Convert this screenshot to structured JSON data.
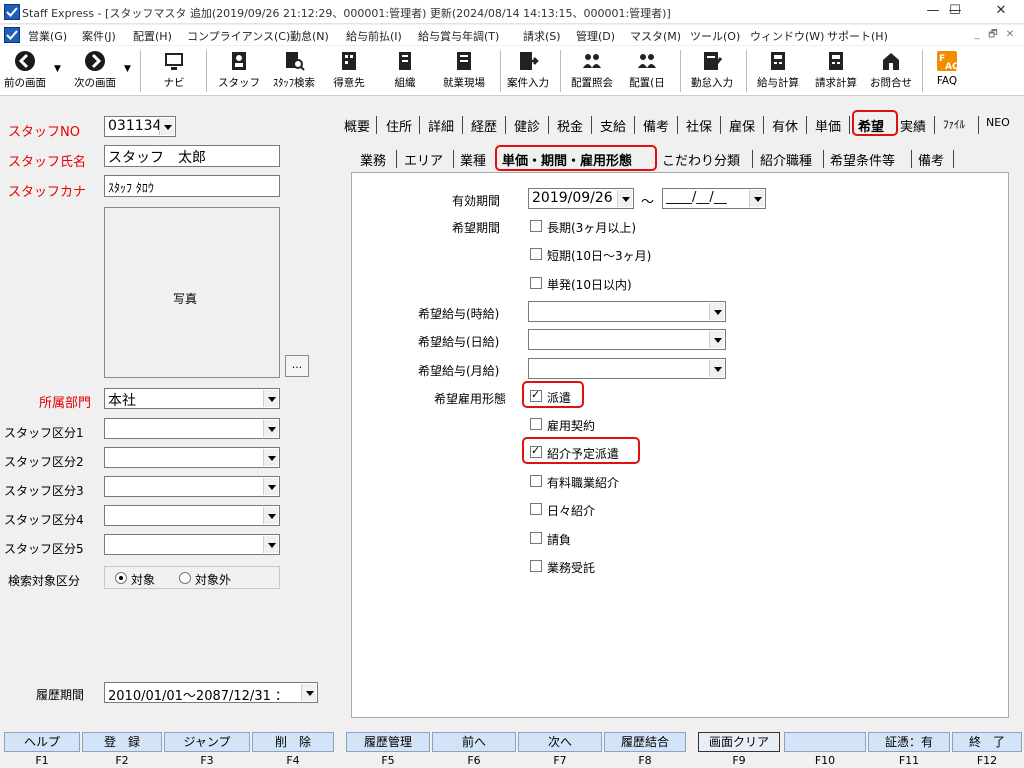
{
  "window": {
    "title": "Staff Express - [スタッフマスタ  追加(2019/09/26 21:12:29、000001:管理者)  更新(2024/08/14 14:13:15、000001:管理者)]",
    "minimize": "—",
    "maximize": "☐",
    "close": "✕"
  },
  "menu": [
    "営業(G)",
    "案件(J)",
    "配置(H)",
    "コンプライアンス(C)",
    "勤怠(N)",
    "給与前払(I)",
    "給与賞与年調(T)",
    "請求(S)",
    "管理(D)",
    "マスタ(M)",
    "ツール(O)",
    "ウィンドウ(W)",
    "サポート(H)"
  ],
  "mdi": [
    "_",
    "🗗",
    "✕"
  ],
  "toolbar": {
    "prev": "前の画面",
    "next": "次の画面",
    "navi": "ナビ",
    "staff": "スタッフ",
    "staff_search": "ｽﾀｯﾌ検索",
    "client": "得意先",
    "org": "組織",
    "site": "就業現場",
    "order_input": "案件入力",
    "assign_view": "配置照会",
    "assign_day": "配置(日",
    "attendance": "勤怠入力",
    "payroll": "給与計算",
    "billing": "請求計算",
    "inquiry": "お問合せ",
    "faq": "FAQ"
  },
  "left": {
    "staff_no_label": "スタッフNO",
    "staff_no": "031134",
    "staff_name_label": "スタッフ氏名",
    "staff_name": "スタッフ　太郎",
    "staff_kana_label": "スタッフカナ",
    "staff_kana": "ｽﾀｯﾌ ﾀﾛｳ",
    "photo_label": "写真",
    "photo_button": "...",
    "dept_label": "所属部門",
    "dept": "本社",
    "class_labels": [
      "スタッフ区分1",
      "スタッフ区分2",
      "スタッフ区分3",
      "スタッフ区分4",
      "スタッフ区分5"
    ],
    "search_label": "検索対象区分",
    "search_on": "対象",
    "search_off": "対象外",
    "history_label": "履歴期間",
    "history": "2010/01/01～2087/12/31 ："
  },
  "tabs_main": [
    "概要",
    "住所",
    "詳細",
    "経歴",
    "健診",
    "税金",
    "支給",
    "備考",
    "社保",
    "雇保",
    "有休",
    "単価",
    "希望",
    "実績",
    "ﾌｧｲﾙ",
    "NEO"
  ],
  "tabs_sub": [
    "業務",
    "エリア",
    "業種",
    "単価・期間・雇用形態",
    "こだわり分類",
    "紹介職種",
    "希望条件等",
    "備考"
  ],
  "form": {
    "valid_period_label": "有効期間",
    "valid_from": "2019/09/26",
    "tilde": "～",
    "valid_to": "____/__/__",
    "desired_period_label": "希望期間",
    "periods": [
      {
        "label": "長期(3ヶ月以上)",
        "checked": false
      },
      {
        "label": "短期(10日～3ヶ月)",
        "checked": false
      },
      {
        "label": "単発(10日以内)",
        "checked": false
      }
    ],
    "wage_hour_label": "希望給与(時給)",
    "wage_day_label": "希望給与(日給)",
    "wage_month_label": "希望給与(月給)",
    "employment_label": "希望雇用形態",
    "employment": [
      {
        "label": "派遣",
        "checked": true
      },
      {
        "label": "雇用契約",
        "checked": false
      },
      {
        "label": "紹介予定派遣",
        "checked": true
      },
      {
        "label": "有料職業紹介",
        "checked": false
      },
      {
        "label": "日々紹介",
        "checked": false
      },
      {
        "label": "請負",
        "checked": false
      },
      {
        "label": "業務受託",
        "checked": false
      }
    ]
  },
  "fkeys": [
    {
      "label": "ヘルプ",
      "num": "F1"
    },
    {
      "label": "登　録",
      "num": "F2"
    },
    {
      "label": "ジャンプ",
      "num": "F3"
    },
    {
      "label": "削　除",
      "num": "F4"
    },
    {
      "label": "履歴管理",
      "num": "F5"
    },
    {
      "label": "前へ",
      "num": "F6"
    },
    {
      "label": "次へ",
      "num": "F7"
    },
    {
      "label": "履歴結合",
      "num": "F8"
    },
    {
      "label": "画面クリア",
      "num": "F9"
    },
    {
      "label": "",
      "num": "F10"
    },
    {
      "label": "証憑：有",
      "num": "F11"
    },
    {
      "label": "終　了",
      "num": "F12"
    }
  ],
  "colors": {
    "required_label": "#e60000",
    "highlight": "#e01010",
    "fkey_bg": "#d4e4f7"
  }
}
